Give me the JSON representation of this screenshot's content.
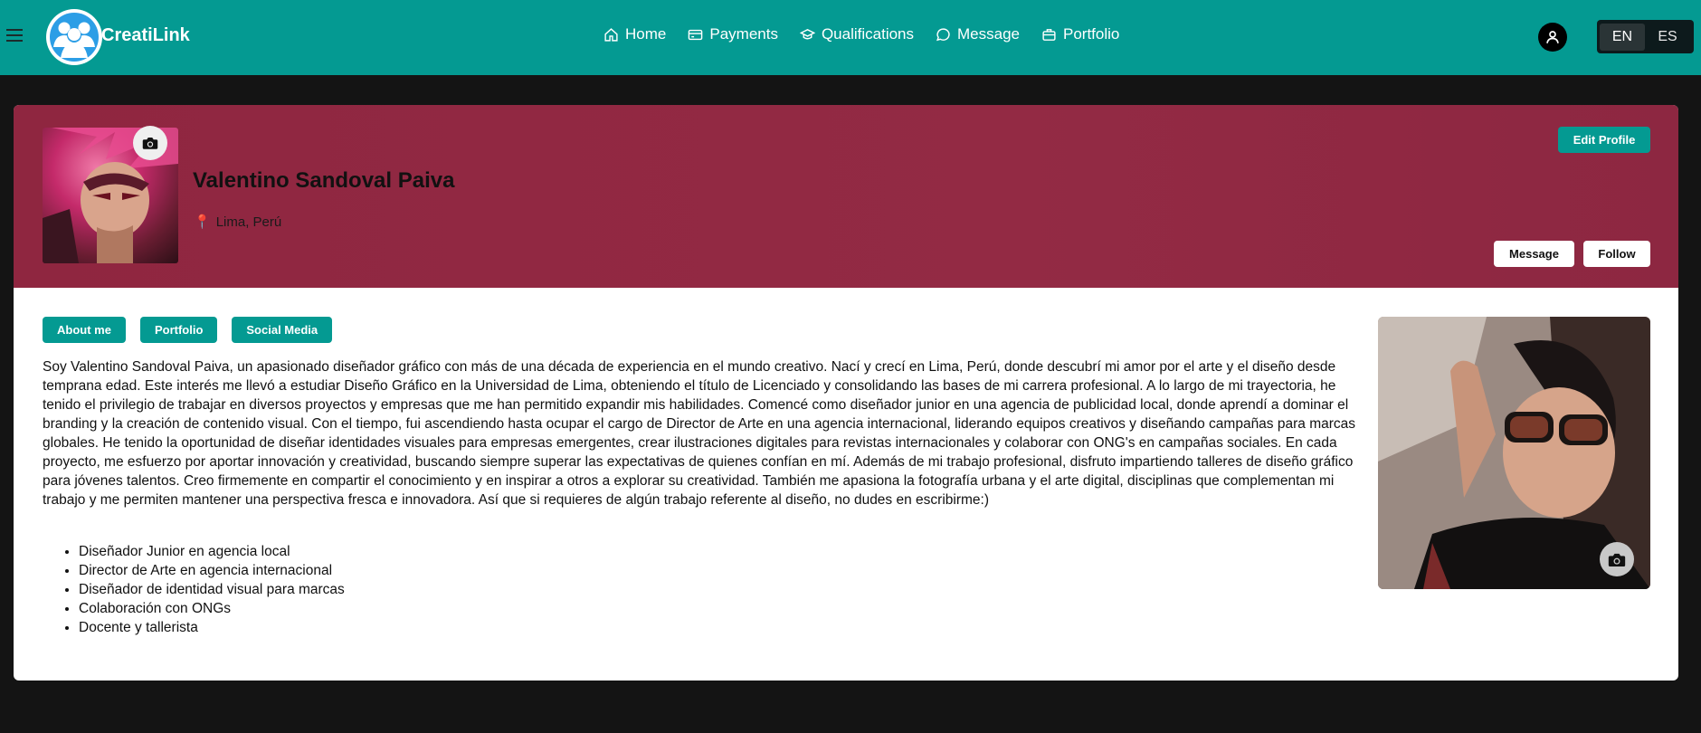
{
  "brand": {
    "name": "CreatiLink"
  },
  "nav": {
    "items": [
      {
        "label": "Home",
        "icon": "home-icon"
      },
      {
        "label": "Payments",
        "icon": "credit-card-icon"
      },
      {
        "label": "Qualifications",
        "icon": "graduation-cap-icon"
      },
      {
        "label": "Message",
        "icon": "chat-bubble-icon"
      },
      {
        "label": "Portfolio",
        "icon": "briefcase-icon"
      }
    ]
  },
  "language": {
    "options": [
      "EN",
      "ES"
    ],
    "selected": "EN"
  },
  "profile": {
    "name": "Valentino Sandoval Paiva",
    "location": "Lima, Perú",
    "edit_label": "Edit Profile",
    "message_label": "Message",
    "follow_label": "Follow"
  },
  "tabs": [
    "About me",
    "Portfolio",
    "Social Media"
  ],
  "about": {
    "text": "Soy Valentino Sandoval Paiva, un apasionado diseñador gráfico con más de una década de experiencia en el mundo creativo. Nací y crecí en Lima, Perú, donde descubrí mi amor por el arte y el diseño desde temprana edad. Este interés me llevó a estudiar Diseño Gráfico en la Universidad de Lima, obteniendo el título de Licenciado y consolidando las bases de mi carrera profesional. A lo largo de mi trayectoria, he tenido el privilegio de trabajar en diversos proyectos y empresas que me han permitido expandir mis habilidades. Comencé como diseñador junior en una agencia de publicidad local, donde aprendí a dominar el branding y la creación de contenido visual. Con el tiempo, fui ascendiendo hasta ocupar el cargo de Director de Arte en una agencia internacional, liderando equipos creativos y diseñando campañas para marcas globales. He tenido la oportunidad de diseñar identidades visuales para empresas emergentes, crear ilustraciones digitales para revistas internacionales y colaborar con ONG's en campañas sociales. En cada proyecto, me esfuerzo por aportar innovación y creatividad, buscando siempre superar las expectativas de quienes confían en mí. Además de mi trabajo profesional, disfruto impartiendo talleres de diseño gráfico para jóvenes talentos. Creo firmemente en compartir el conocimiento y en inspirar a otros a explorar su creatividad. También me apasiona la fotografía urbana y el arte digital, disciplinas que complementan mi trabajo y me permiten mantener una perspectiva fresca e innovadora. Así que si requieres de algún trabajo referente al diseño, no dudes en escribirme:)",
    "list": [
      "Diseñador Junior en agencia local",
      "Director de Arte en agencia internacional",
      "Diseñador de identidad visual para marcas",
      "Colaboración con ONGs",
      "Docente y tallerista"
    ]
  },
  "colors": {
    "navbar": "#049a92",
    "banner": "#912842",
    "accent": "#049a92",
    "background": "#141414"
  }
}
